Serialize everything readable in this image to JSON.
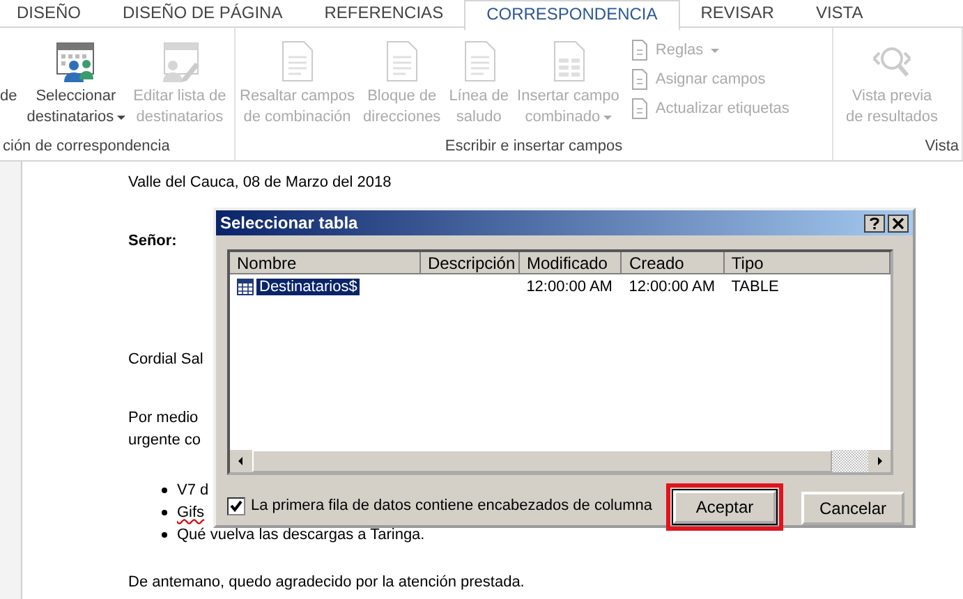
{
  "tabs": [
    {
      "label": "DISEÑO",
      "selected": false
    },
    {
      "label": "DISEÑO DE PÁGINA",
      "selected": false
    },
    {
      "label": "REFERENCIAS",
      "selected": false
    },
    {
      "label": "CORRESPONDENCIA",
      "selected": true
    },
    {
      "label": "REVISAR",
      "selected": false
    },
    {
      "label": "VISTA",
      "selected": false
    }
  ],
  "ribbon": {
    "groups": [
      {
        "label": "ción de correspondencia",
        "buttons": [
          {
            "kind": "fragment",
            "label": "de"
          },
          {
            "kind": "large",
            "label": "Seleccionar\ndestinatarios",
            "disabled": false,
            "has_menu": true
          },
          {
            "kind": "large",
            "label": "Editar lista de\ndestinatarios",
            "disabled": true,
            "has_menu": false
          }
        ]
      },
      {
        "label": "Escribir e insertar campos",
        "buttons": [
          {
            "kind": "large",
            "label": "Resaltar campos\nde combinación",
            "disabled": true,
            "has_menu": false
          },
          {
            "kind": "large",
            "label": "Bloque de\ndirecciones",
            "disabled": true,
            "has_menu": false
          },
          {
            "kind": "large",
            "label": "Línea de\nsaludo",
            "disabled": true,
            "has_menu": false
          },
          {
            "kind": "large",
            "label": "Insertar campo\ncombinado",
            "disabled": true,
            "has_menu": true
          },
          {
            "kind": "small",
            "label": "Reglas",
            "disabled": true,
            "has_menu": true
          },
          {
            "kind": "small",
            "label": "Asignar campos",
            "disabled": true,
            "has_menu": false
          },
          {
            "kind": "small",
            "label": "Actualizar etiquetas",
            "disabled": true,
            "has_menu": false
          }
        ]
      },
      {
        "label": "Vista",
        "buttons": [
          {
            "kind": "large",
            "label": "Vista previa\nde resultados",
            "disabled": true,
            "has_menu": false
          }
        ]
      }
    ]
  },
  "document": {
    "blocks": [
      {
        "kind": "para",
        "text": "Valle del Cauca, 08 de Marzo del 2018",
        "bold": false
      },
      {
        "kind": "para",
        "text": "Señor:",
        "bold": true
      },
      {
        "kind": "para",
        "text": "Cordial Sal",
        "bold": false
      },
      {
        "kind": "para",
        "text": "Por medio\nurgente co",
        "bold": false
      },
      {
        "kind": "bullets",
        "items": [
          {
            "text": "V7 d",
            "misspelled": false
          },
          {
            "text": "Gifs",
            "misspelled": true
          },
          {
            "text": "Qué vuelva las descargas a Taringa.",
            "misspelled": false
          }
        ]
      },
      {
        "kind": "para",
        "text": "De antemano, quedo agradecido por la atención prestada.",
        "bold": false
      }
    ]
  },
  "dialog": {
    "title": "Seleccionar tabla",
    "columns": [
      "Nombre",
      "Descripción",
      "Modificado",
      "Creado",
      "Tipo"
    ],
    "rows": [
      {
        "cells": [
          "Destinatarios$",
          "",
          "12:00:00 AM",
          "12:00:00 AM",
          "TABLE"
        ],
        "selected": true
      }
    ],
    "checkbox": {
      "label": "La primera fila de datos contiene encabezados de columna",
      "checked": true
    },
    "buttons": [
      {
        "label": "Aceptar",
        "highlighted": true
      },
      {
        "label": "Cancelar",
        "highlighted": false
      }
    ]
  }
}
